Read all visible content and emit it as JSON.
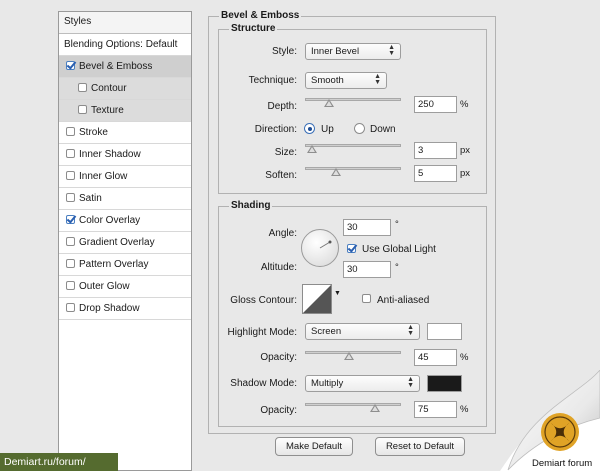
{
  "styles_panel": {
    "header": "Styles",
    "items": [
      {
        "label": "Blending Options: Default",
        "kind": "plain"
      },
      {
        "label": "Bevel & Emboss",
        "checked": true,
        "kind": "main",
        "selected": true
      },
      {
        "label": "Contour",
        "checked": false,
        "kind": "sub"
      },
      {
        "label": "Texture",
        "checked": false,
        "kind": "sub"
      },
      {
        "label": "Stroke",
        "checked": false,
        "kind": "main"
      },
      {
        "label": "Inner Shadow",
        "checked": false,
        "kind": "main"
      },
      {
        "label": "Inner Glow",
        "checked": false,
        "kind": "main"
      },
      {
        "label": "Satin",
        "checked": false,
        "kind": "main"
      },
      {
        "label": "Color Overlay",
        "checked": true,
        "kind": "main"
      },
      {
        "label": "Gradient Overlay",
        "checked": false,
        "kind": "main"
      },
      {
        "label": "Pattern Overlay",
        "checked": false,
        "kind": "main"
      },
      {
        "label": "Outer Glow",
        "checked": false,
        "kind": "main"
      },
      {
        "label": "Drop Shadow",
        "checked": false,
        "kind": "main"
      }
    ]
  },
  "bevel": {
    "title": "Bevel & Emboss",
    "structure": {
      "title": "Structure",
      "style_label": "Style:",
      "style_value": "Inner Bevel",
      "technique_label": "Technique:",
      "technique_value": "Smooth",
      "depth_label": "Depth:",
      "depth_value": "250",
      "depth_unit": "%",
      "depth_slider_fraction": 0.22,
      "direction_label": "Direction:",
      "direction_up": "Up",
      "direction_down": "Down",
      "direction_selected": "Up",
      "size_label": "Size:",
      "size_value": "3",
      "size_unit": "px",
      "size_slider_fraction": 0.02,
      "soften_label": "Soften:",
      "soften_value": "5",
      "soften_unit": "px",
      "soften_slider_fraction": 0.3
    },
    "shading": {
      "title": "Shading",
      "angle_label": "Angle:",
      "angle_value": "30",
      "angle_unit": "°",
      "use_global_light_label": "Use Global Light",
      "use_global_light_checked": true,
      "altitude_label": "Altitude:",
      "altitude_value": "30",
      "altitude_unit": "°",
      "gloss_contour_label": "Gloss Contour:",
      "anti_aliased_label": "Anti-aliased",
      "anti_aliased_checked": false,
      "highlight_mode_label": "Highlight Mode:",
      "highlight_mode_value": "Screen",
      "highlight_color": "#ffffff",
      "highlight_opacity_label": "Opacity:",
      "highlight_opacity_value": "45",
      "highlight_opacity_unit": "%",
      "highlight_opacity_fraction": 0.45,
      "shadow_mode_label": "Shadow Mode:",
      "shadow_mode_value": "Multiply",
      "shadow_color": "#1a1a1a",
      "shadow_opacity_label": "Opacity:",
      "shadow_opacity_value": "75",
      "shadow_opacity_unit": "%",
      "shadow_opacity_fraction": 0.75
    },
    "make_default_label": "Make Default",
    "reset_default_label": "Reset to Default"
  },
  "watermark": {
    "url_text": "Demiart.ru/forum/",
    "brand_text": "Demiart forum",
    "accent_color": "#556b2f"
  }
}
